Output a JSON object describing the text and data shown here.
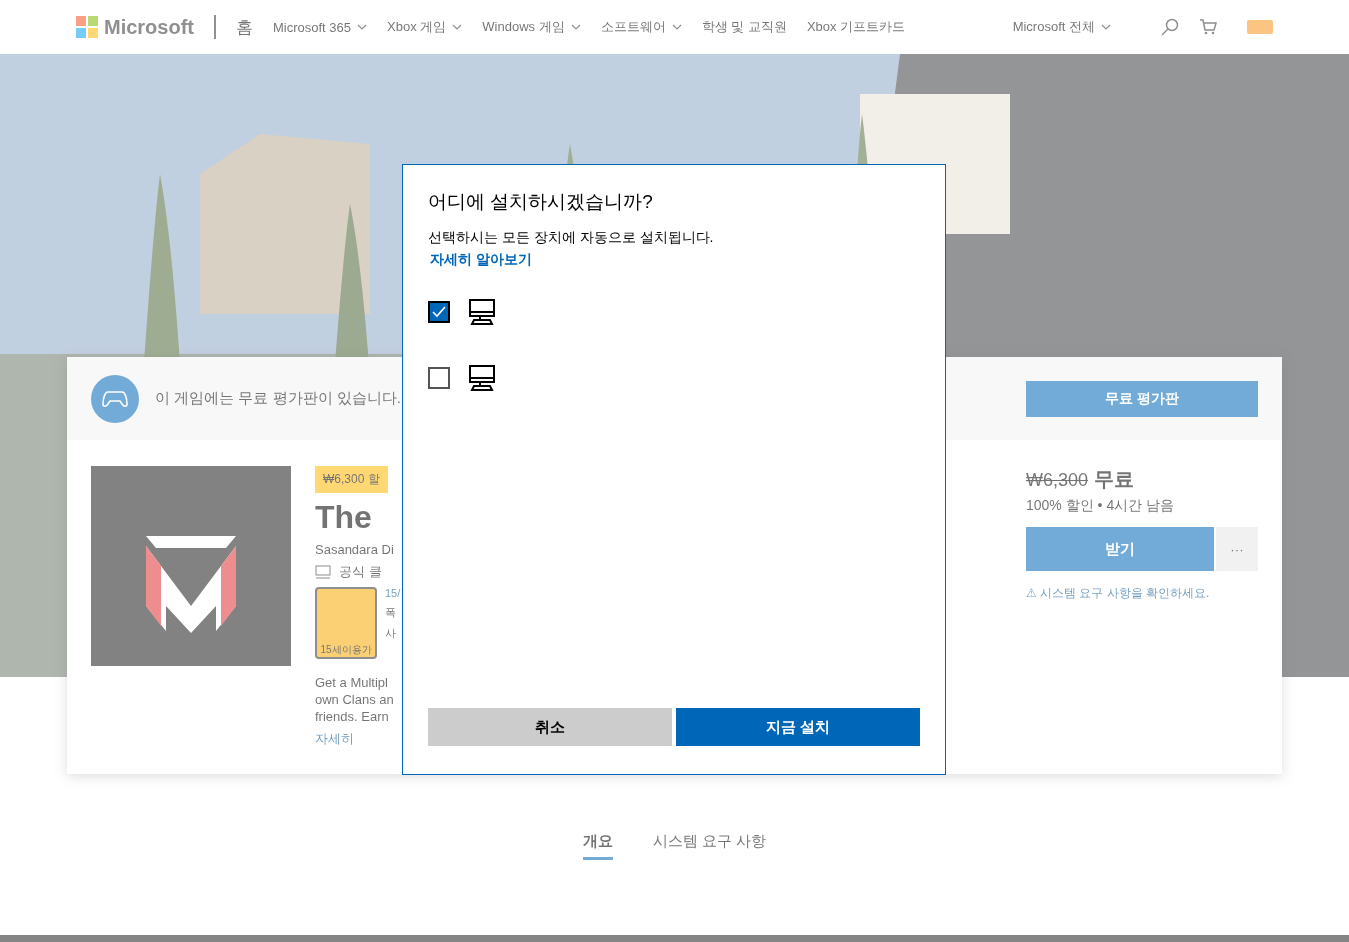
{
  "header": {
    "brand": "Microsoft",
    "home": "홈",
    "nav": [
      {
        "label": "Microsoft 365",
        "dropdown": true
      },
      {
        "label": "Xbox 게임",
        "dropdown": true
      },
      {
        "label": "Windows 게임",
        "dropdown": true
      },
      {
        "label": "소프트웨어",
        "dropdown": true
      },
      {
        "label": "학생 및 교직원",
        "dropdown": false
      },
      {
        "label": "Xbox 기프트카드",
        "dropdown": false
      }
    ],
    "all": "Microsoft 전체"
  },
  "trial_banner": {
    "text": "이 게임에는 무료 평가판이 있습니다.",
    "button": "무료 평가판"
  },
  "product": {
    "discount_badge": "₩6,300 할",
    "title": "The",
    "publisher": "Sasandara Di",
    "club": "공식 클",
    "rating_badge": "15세이용가",
    "rating_lines": [
      "15/",
      "폭",
      "사"
    ],
    "description": [
      "Get a Multipl",
      "own Clans an",
      "friends. Earn"
    ],
    "more_link": "자세히"
  },
  "purchase": {
    "old_price": "₩6,300",
    "price": "무료",
    "discount": "100% 할인 • 4시간 남음",
    "get_button": "받기",
    "more_button": "···",
    "warning": "⚠ 시스템 요구 사항을 확인하세요."
  },
  "tabs": [
    {
      "label": "개요",
      "selected": true
    },
    {
      "label": "시스템 요구 사항",
      "selected": false
    }
  ],
  "dialog": {
    "title": "어디에 설치하시겠습니까?",
    "subtitle": "선택하시는 모든 장치에 자동으로 설치됩니다.",
    "link": "자세히 알아보기",
    "devices": [
      {
        "checked": true
      },
      {
        "checked": false
      }
    ],
    "cancel": "취소",
    "install": "지금 설치"
  }
}
